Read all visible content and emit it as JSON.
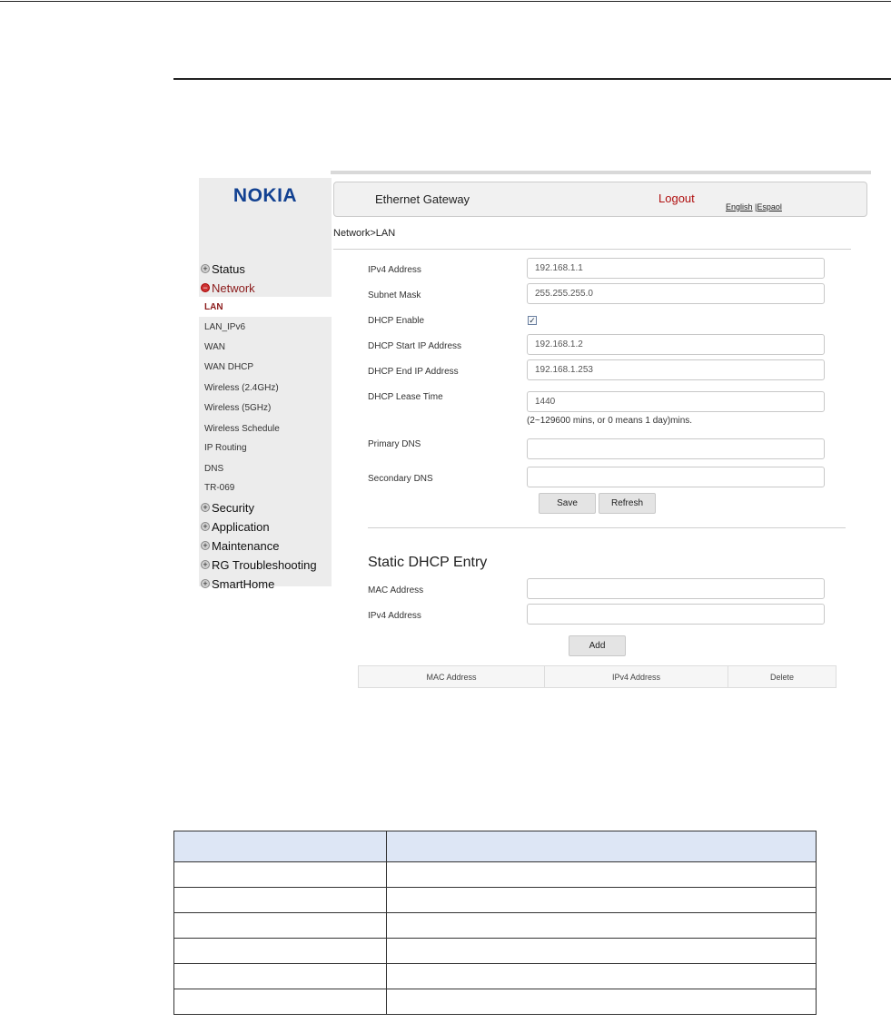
{
  "app": {
    "logo": "NOKIA",
    "title": "Ethernet Gateway",
    "logout": "Logout",
    "lang_english": "English",
    "lang_sep": "|",
    "lang_espanol": "Espaol"
  },
  "breadcrumb": "Network>LAN",
  "sidebar": {
    "top_sections": [
      {
        "label": "Status",
        "icon": "plus-icon"
      },
      {
        "label": "Network",
        "icon": "minus-icon",
        "active": true
      }
    ],
    "network_items": [
      "LAN",
      "LAN_IPv6",
      "WAN",
      "WAN DHCP",
      "Wireless (2.4GHz)",
      "Wireless (5GHz)",
      "Wireless Schedule",
      "IP Routing",
      "DNS",
      "TR-069"
    ],
    "active_item": "LAN",
    "bottom_sections": [
      "Security",
      "Application",
      "Maintenance",
      "RG Troubleshooting",
      "SmartHome"
    ]
  },
  "form": {
    "ipv4_label": "IPv4 Address",
    "ipv4_value": "192.168.1.1",
    "subnet_label": "Subnet Mask",
    "subnet_value": "255.255.255.0",
    "dhcp_enable_label": "DHCP Enable",
    "dhcp_enable_checked": true,
    "dhcp_start_label": "DHCP Start IP Address",
    "dhcp_start_value": "192.168.1.2",
    "dhcp_end_label": "DHCP End IP Address",
    "dhcp_end_value": "192.168.1.253",
    "lease_label": "DHCP Lease Time",
    "lease_value": "1440",
    "lease_hint": "(2~129600 mins, or 0 means 1 day)mins.",
    "primary_dns_label": "Primary DNS",
    "primary_dns_value": "",
    "secondary_dns_label": "Secondary DNS",
    "secondary_dns_value": "",
    "save_label": "Save",
    "refresh_label": "Refresh"
  },
  "static_dhcp": {
    "title": "Static DHCP Entry",
    "mac_label": "MAC Address",
    "mac_value": "",
    "ipv4_label": "IPv4 Address",
    "ipv4_value": "",
    "add_label": "Add",
    "columns": [
      "MAC Address",
      "IPv4 Address",
      "Delete"
    ]
  },
  "doc_table": {
    "header": [
      "",
      ""
    ],
    "rows": [
      [
        "",
        ""
      ],
      [
        "",
        ""
      ],
      [
        "",
        ""
      ],
      [
        "",
        ""
      ],
      [
        "",
        ""
      ],
      [
        "",
        ""
      ]
    ]
  },
  "colors": {
    "brand": "#124191",
    "logout": "#b01010",
    "active_nav": "#8b1a1a",
    "table_header": "#dde6f5"
  }
}
